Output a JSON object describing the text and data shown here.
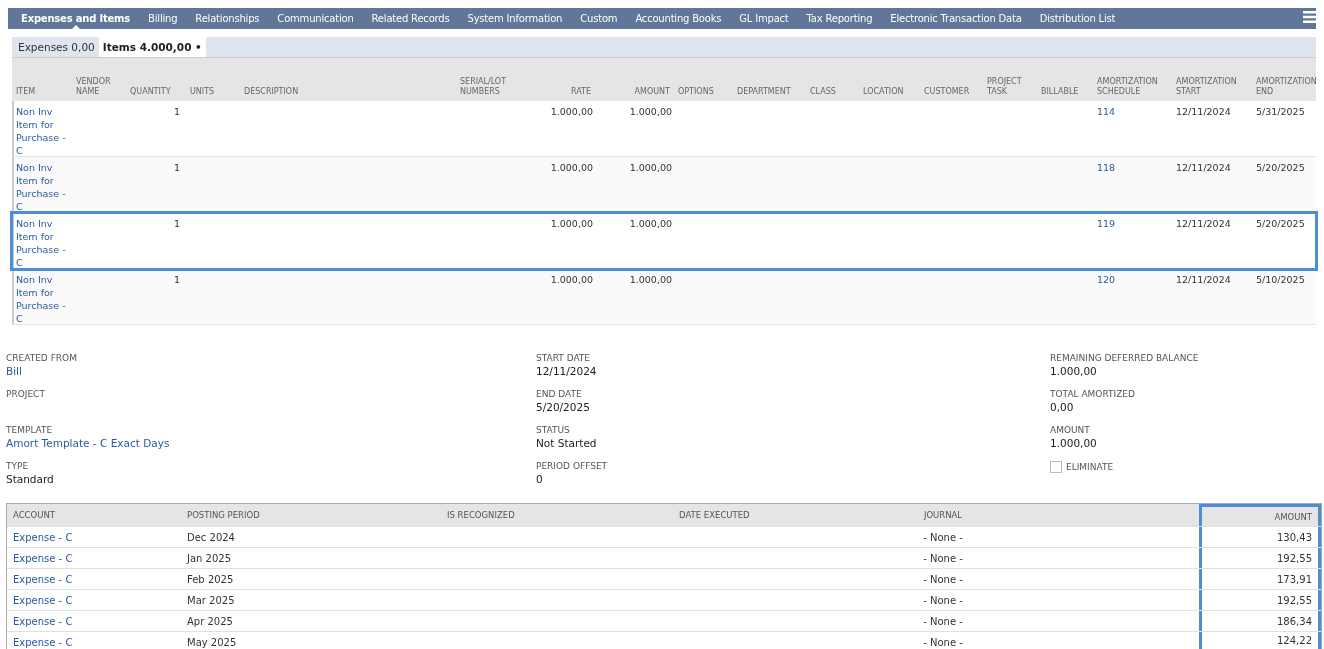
{
  "tabs": [
    {
      "label": "Expenses and Items",
      "selected": true
    },
    {
      "label": "Billing",
      "selected": false
    },
    {
      "label": "Relationships",
      "selected": false
    },
    {
      "label": "Communication",
      "selected": false
    },
    {
      "label": "Related Records",
      "selected": false
    },
    {
      "label": "System Information",
      "selected": false
    },
    {
      "label": "Custom",
      "selected": false
    },
    {
      "label": "Accounting Books",
      "selected": false
    },
    {
      "label": "GL Impact",
      "selected": false
    },
    {
      "label": "Tax Reporting",
      "selected": false
    },
    {
      "label": "Electronic Transaction Data",
      "selected": false
    },
    {
      "label": "Distribution List",
      "selected": false
    }
  ],
  "subtabs": [
    {
      "label": "Expenses 0,00",
      "selected": false
    },
    {
      "label": "Items 4.000,00 •",
      "selected": true
    }
  ],
  "items_table": {
    "columns": [
      "ITEM",
      "VENDOR NAME",
      "QUANTITY",
      "UNITS",
      "DESCRIPTION",
      "SERIAL/LOT NUMBERS",
      "RATE",
      "AMOUNT",
      "OPTIONS",
      "DEPARTMENT",
      "CLASS",
      "LOCATION",
      "CUSTOMER",
      "PROJECT TASK",
      "BILLABLE",
      "AMORTIZATION SCHEDULE",
      "AMORTIZATION START",
      "AMORTIZATION END"
    ],
    "rows": [
      {
        "highlighted": false,
        "item": "Non Inv Item for Purchase - C",
        "quantity": "1",
        "rate": "1.000,00",
        "amount": "1.000,00",
        "schedule": "114",
        "start": "12/11/2024",
        "end": "5/31/2025"
      },
      {
        "highlighted": false,
        "item": "Non Inv Item for Purchase - C",
        "quantity": "1",
        "rate": "1.000,00",
        "amount": "1.000,00",
        "schedule": "118",
        "start": "12/11/2024",
        "end": "5/20/2025"
      },
      {
        "highlighted": true,
        "item": "Non Inv Item for Purchase - C",
        "quantity": "1",
        "rate": "1.000,00",
        "amount": "1.000,00",
        "schedule": "119",
        "start": "12/11/2024",
        "end": "5/20/2025"
      },
      {
        "highlighted": false,
        "item": "Non Inv Item for Purchase - C",
        "quantity": "1",
        "rate": "1.000,00",
        "amount": "1.000,00",
        "schedule": "120",
        "start": "12/11/2024",
        "end": "5/10/2025"
      }
    ]
  },
  "fields": [
    [
      {
        "label": "CREATED FROM",
        "value": "Bill",
        "link": true
      },
      {
        "label": "PROJECT"
      },
      {
        "label": "TEMPLATE",
        "value": "Amort Template - C Exact Days",
        "link": true
      },
      {
        "label": "TYPE",
        "value": "Standard",
        "link": false
      }
    ],
    [
      {
        "label": "START DATE",
        "value": "12/11/2024",
        "link": false
      },
      {
        "label": "END DATE",
        "value": "5/20/2025",
        "link": false
      },
      {
        "label": "STATUS",
        "value": "Not Started",
        "link": false
      },
      {
        "label": "PERIOD OFFSET",
        "value": "0",
        "link": false
      }
    ],
    [
      {
        "label": "REMAINING DEFERRED BALANCE",
        "value": "1.000,00",
        "link": false
      },
      {
        "label": "TOTAL AMORTIZED",
        "value": "0,00",
        "link": false
      },
      {
        "label": "AMOUNT",
        "value": "1.000,00",
        "link": false
      }
    ]
  ],
  "eliminate": {
    "label": "ELIMINATE",
    "checked": false
  },
  "schedule": {
    "columns": [
      {
        "label": "ACCOUNT",
        "highlighted": false
      },
      {
        "label": "POSTING PERIOD",
        "highlighted": false
      },
      {
        "label": "IS RECOGNIZED",
        "highlighted": false
      },
      {
        "label": "DATE EXECUTED",
        "highlighted": false
      },
      {
        "label": "JOURNAL",
        "highlighted": false
      },
      {
        "label": "AMOUNT",
        "highlighted": true
      }
    ],
    "rows": [
      {
        "account": "Expense - C",
        "period": "Dec 2024",
        "journal": "- None -",
        "amount": "130,43"
      },
      {
        "account": "Expense - C",
        "period": "Jan 2025",
        "journal": "- None -",
        "amount": "192,55"
      },
      {
        "account": "Expense - C",
        "period": "Feb 2025",
        "journal": "- None -",
        "amount": "173,91"
      },
      {
        "account": "Expense - C",
        "period": "Mar 2025",
        "journal": "- None -",
        "amount": "192,55"
      },
      {
        "account": "Expense - C",
        "period": "Apr 2025",
        "journal": "- None -",
        "amount": "186,34"
      },
      {
        "account": "Expense - C",
        "period": "May 2025",
        "journal": "- None -",
        "amount": "124,22"
      }
    ]
  }
}
